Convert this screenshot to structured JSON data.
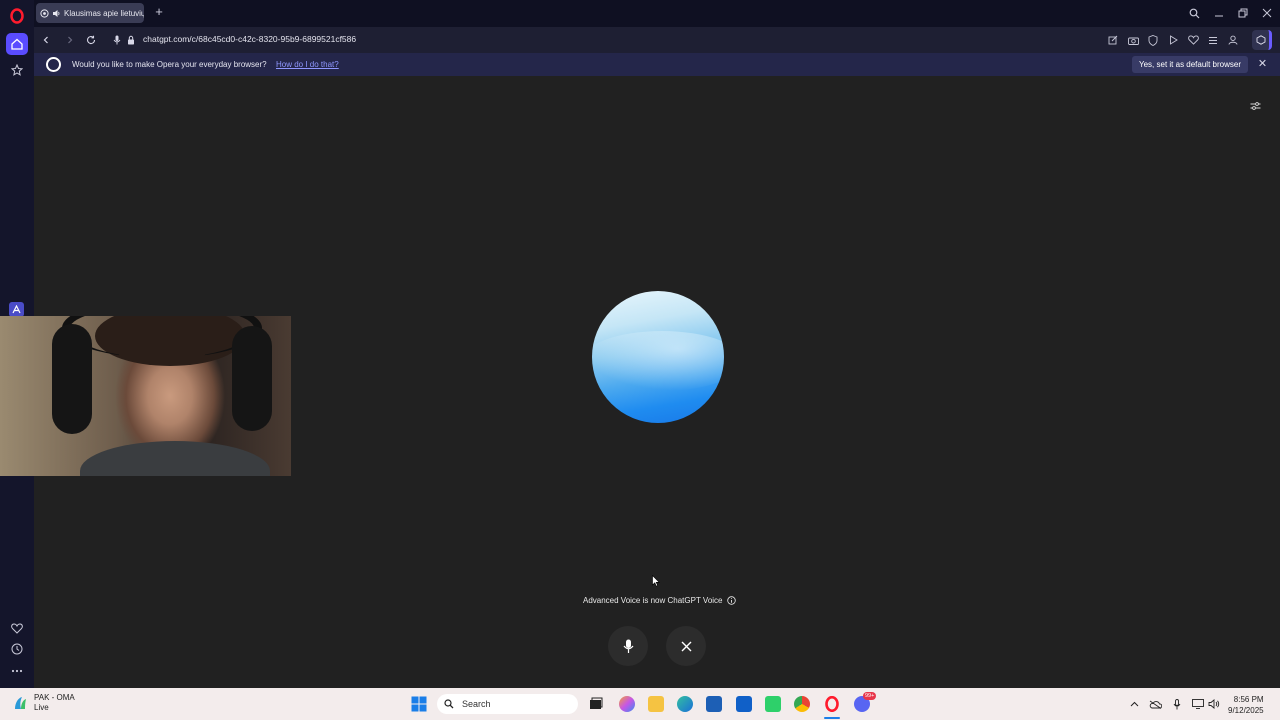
{
  "browser": {
    "tab": {
      "title": "Klausimas apie lietuvių"
    },
    "address": {
      "url": "chatgpt.com/c/68c45cd0-c42c-8320-95b9-6899521cf586"
    },
    "infobar": {
      "message": "Would you like to make Opera your everyday browser?",
      "link": "How do I do that?",
      "button": "Yes, set it as default browser"
    }
  },
  "voice": {
    "note": "Advanced Voice is now ChatGPT Voice"
  },
  "taskbar": {
    "weather": {
      "line1": "PAK - OMA",
      "line2": "Live"
    },
    "search_placeholder": "Search",
    "time": "8:56 PM",
    "date": "9/12/2025",
    "badge": "99+"
  },
  "colors": {
    "sidebar_bg": "#14152b",
    "page_bg": "#212121",
    "orb_blue": "#1f8cf0",
    "opera_red": "#ff1b2d",
    "accent_purple": "#6a5cff"
  }
}
